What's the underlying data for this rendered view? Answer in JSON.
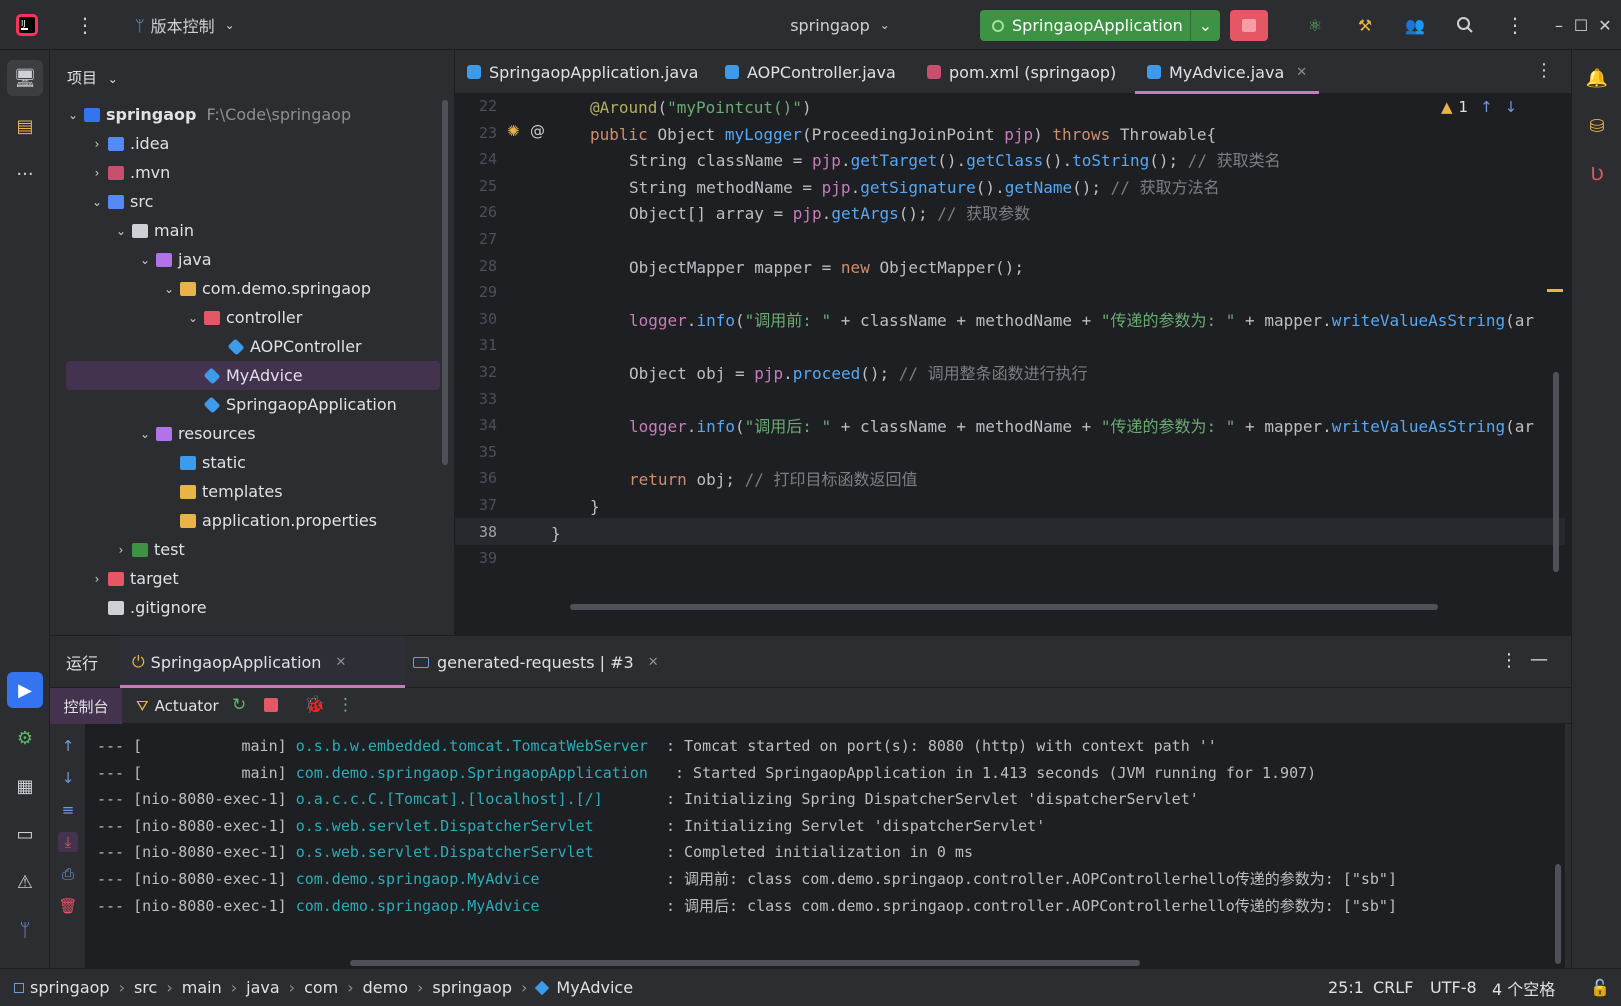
{
  "titlebar": {
    "vcs_label": "版本控制",
    "project_name": "springaop",
    "run_config": "SpringaopApplication"
  },
  "project_panel": {
    "header": "项目",
    "tree": [
      {
        "label": "springaop",
        "path": "F:\\Code\\springaop",
        "depth": 0,
        "expanded": true,
        "icon": "module-folder-icon",
        "color": "#3574f0"
      },
      {
        "label": ".idea",
        "depth": 1,
        "expanded": false,
        "icon": "folder-icon",
        "color": "#548af7"
      },
      {
        "label": ".mvn",
        "depth": 1,
        "expanded": false,
        "icon": "folder-icon",
        "color": "#c94f6f"
      },
      {
        "label": "src",
        "depth": 1,
        "expanded": true,
        "icon": "source-folder-icon",
        "color": "#548af7"
      },
      {
        "label": "main",
        "depth": 2,
        "expanded": true,
        "icon": "folder-icon",
        "color": "#ced0d6"
      },
      {
        "label": "java",
        "depth": 3,
        "expanded": true,
        "icon": "java-source-folder-icon",
        "color": "#b074e8"
      },
      {
        "label": "com.demo.springaop",
        "depth": 4,
        "expanded": true,
        "icon": "package-icon",
        "color": "#e8b447"
      },
      {
        "label": "controller",
        "depth": 5,
        "expanded": true,
        "icon": "package-icon",
        "color": "#e55765"
      },
      {
        "label": "AOPController",
        "depth": 6,
        "icon": "class-icon",
        "color": "#3d9be9"
      },
      {
        "label": "MyAdvice",
        "depth": 5,
        "icon": "class-icon",
        "color": "#3d9be9",
        "selected": true
      },
      {
        "label": "SpringaopApplication",
        "depth": 5,
        "icon": "spring-class-icon",
        "color": "#3d9be9"
      },
      {
        "label": "resources",
        "depth": 3,
        "expanded": true,
        "icon": "resources-folder-icon",
        "color": "#b074e8"
      },
      {
        "label": "static",
        "depth": 4,
        "icon": "web-folder-icon",
        "color": "#3d9be9"
      },
      {
        "label": "templates",
        "depth": 4,
        "icon": "folder-icon",
        "color": "#e8b447"
      },
      {
        "label": "application.properties",
        "depth": 4,
        "icon": "properties-file-icon",
        "color": "#e8b447"
      },
      {
        "label": "test",
        "depth": 2,
        "expanded": false,
        "icon": "test-folder-icon",
        "color": "#3d9244"
      },
      {
        "label": "target",
        "depth": 1,
        "expanded": false,
        "icon": "excluded-folder-icon",
        "color": "#e55765"
      },
      {
        "label": ".gitignore",
        "depth": 1,
        "icon": "git-file-icon",
        "color": "#ced0d6"
      }
    ]
  },
  "editor": {
    "tabs": [
      {
        "label": "SpringaopApplication.java",
        "icon": "spring-class-icon",
        "color": "#3d9be9"
      },
      {
        "label": "AOPController.java",
        "icon": "class-icon",
        "color": "#3d9be9"
      },
      {
        "label": "pom.xml (springaop)",
        "icon": "maven-icon",
        "color": "#c94f6f"
      },
      {
        "label": "MyAdvice.java",
        "icon": "class-icon",
        "color": "#3d9be9",
        "active": true
      }
    ],
    "warning_count": "1",
    "current_line": "38",
    "lines": [
      {
        "n": "22",
        "parts": [
          [
            "an",
            "@Around"
          ],
          [
            "t",
            "("
          ],
          [
            "s",
            "\"myPointcut()\""
          ],
          [
            "t",
            ")"
          ]
        ],
        "indent": 1
      },
      {
        "n": "23",
        "parts": [
          [
            "k",
            "public "
          ],
          [
            "t",
            "Object "
          ],
          [
            "f",
            "myLogger"
          ],
          [
            "t",
            "(ProceedingJoinPoint "
          ],
          [
            "p",
            "pjp"
          ],
          [
            "t",
            ") "
          ],
          [
            "k",
            "throws "
          ],
          [
            "t",
            "Throwable{"
          ]
        ],
        "indent": 1
      },
      {
        "n": "24",
        "parts": [
          [
            "t",
            "String className = "
          ],
          [
            "p",
            "pjp"
          ],
          [
            "t",
            "."
          ],
          [
            "f",
            "getTarget"
          ],
          [
            "t",
            "()."
          ],
          [
            "f",
            "getClass"
          ],
          [
            "t",
            "()."
          ],
          [
            "f",
            "toString"
          ],
          [
            "t",
            "(); "
          ],
          [
            "c",
            "// 获取类名"
          ]
        ],
        "indent": 2
      },
      {
        "n": "25",
        "parts": [
          [
            "t",
            "String methodName = "
          ],
          [
            "p",
            "pjp"
          ],
          [
            "t",
            "."
          ],
          [
            "f",
            "getSignature"
          ],
          [
            "t",
            "()."
          ],
          [
            "f",
            "getName"
          ],
          [
            "t",
            "(); "
          ],
          [
            "c",
            "// 获取方法名"
          ]
        ],
        "indent": 2
      },
      {
        "n": "26",
        "parts": [
          [
            "t",
            "Object[] array = "
          ],
          [
            "p",
            "pjp"
          ],
          [
            "t",
            "."
          ],
          [
            "f",
            "getArgs"
          ],
          [
            "t",
            "(); "
          ],
          [
            "c",
            "// 获取参数"
          ]
        ],
        "indent": 2
      },
      {
        "n": "27",
        "parts": [],
        "indent": 0
      },
      {
        "n": "28",
        "parts": [
          [
            "t",
            "ObjectMapper mapper = "
          ],
          [
            "k",
            "new "
          ],
          [
            "t",
            "ObjectMapper();"
          ]
        ],
        "indent": 2
      },
      {
        "n": "29",
        "parts": [],
        "indent": 0
      },
      {
        "n": "30",
        "parts": [
          [
            "p",
            "logger"
          ],
          [
            "t",
            "."
          ],
          [
            "f",
            "info"
          ],
          [
            "t",
            "("
          ],
          [
            "s",
            "\"调用前: \""
          ],
          [
            "t",
            " + className + methodName + "
          ],
          [
            "s",
            "\"传递的参数为: \""
          ],
          [
            "t",
            " + mapper."
          ],
          [
            "f",
            "writeValueAsString"
          ],
          [
            "t",
            "(ar"
          ]
        ],
        "indent": 2
      },
      {
        "n": "31",
        "parts": [],
        "indent": 0
      },
      {
        "n": "32",
        "parts": [
          [
            "t",
            "Object obj = "
          ],
          [
            "p",
            "pjp"
          ],
          [
            "t",
            "."
          ],
          [
            "f",
            "proceed"
          ],
          [
            "t",
            "(); "
          ],
          [
            "c",
            "// 调用整条函数进行执行"
          ]
        ],
        "indent": 2
      },
      {
        "n": "33",
        "parts": [],
        "indent": 0
      },
      {
        "n": "34",
        "parts": [
          [
            "p",
            "logger"
          ],
          [
            "t",
            "."
          ],
          [
            "f",
            "info"
          ],
          [
            "t",
            "("
          ],
          [
            "s",
            "\"调用后: \""
          ],
          [
            "t",
            " + className + methodName + "
          ],
          [
            "s",
            "\"传递的参数为: \""
          ],
          [
            "t",
            " + mapper."
          ],
          [
            "f",
            "writeValueAsString"
          ],
          [
            "t",
            "(ar"
          ]
        ],
        "indent": 2
      },
      {
        "n": "35",
        "parts": [],
        "indent": 0
      },
      {
        "n": "36",
        "parts": [
          [
            "k",
            "return "
          ],
          [
            "t",
            "obj; "
          ],
          [
            "c",
            "// 打印目标函数返回值"
          ]
        ],
        "indent": 2
      },
      {
        "n": "37",
        "parts": [
          [
            "t",
            "}"
          ]
        ],
        "indent": 1
      },
      {
        "n": "38",
        "parts": [
          [
            "t",
            "}"
          ]
        ],
        "indent": 0
      },
      {
        "n": "39",
        "parts": [],
        "indent": 0
      }
    ]
  },
  "run_panel": {
    "title": "运行",
    "tabs": [
      {
        "label": "SpringaopApplication",
        "active": true
      },
      {
        "label": "generated-requests | #3",
        "active": false
      }
    ],
    "console_tab": "控制台",
    "actuator_tab": "Actuator",
    "log": [
      {
        "thread": "--- [           main] ",
        "logger": "o.s.b.w.embedded.tomcat.TomcatWebServer ",
        "msg": " : Tomcat started on port(s): 8080 (http) with context path ''"
      },
      {
        "thread": "--- [           main] ",
        "logger": "com.demo.springaop.SpringaopApplication  ",
        "msg": " : Started SpringaopApplication in 1.413 seconds (JVM running for 1.907)"
      },
      {
        "thread": "--- [nio-8080-exec-1] ",
        "logger": "o.a.c.c.C.[Tomcat].[localhost].[/]      ",
        "msg": " : Initializing Spring DispatcherServlet 'dispatcherServlet'"
      },
      {
        "thread": "--- [nio-8080-exec-1] ",
        "logger": "o.s.web.servlet.DispatcherServlet       ",
        "msg": " : Initializing Servlet 'dispatcherServlet'"
      },
      {
        "thread": "--- [nio-8080-exec-1] ",
        "logger": "o.s.web.servlet.DispatcherServlet       ",
        "msg": " : Completed initialization in 0 ms"
      },
      {
        "thread": "--- [nio-8080-exec-1] ",
        "logger": "com.demo.springaop.MyAdvice             ",
        "msg": " : 调用前: class com.demo.springaop.controller.AOPControllerhello传递的参数为: [\"sb\"]"
      },
      {
        "thread": "--- [nio-8080-exec-1] ",
        "logger": "com.demo.springaop.MyAdvice             ",
        "msg": " : 调用后: class com.demo.springaop.controller.AOPControllerhello传递的参数为: [\"sb\"]"
      }
    ]
  },
  "statusbar": {
    "breadcrumbs": [
      "springaop",
      "src",
      "main",
      "java",
      "com",
      "demo",
      "springaop",
      "MyAdvice"
    ],
    "position": "25:1",
    "line_sep": "CRLF",
    "encoding": "UTF-8",
    "indent": "4 个空格"
  }
}
